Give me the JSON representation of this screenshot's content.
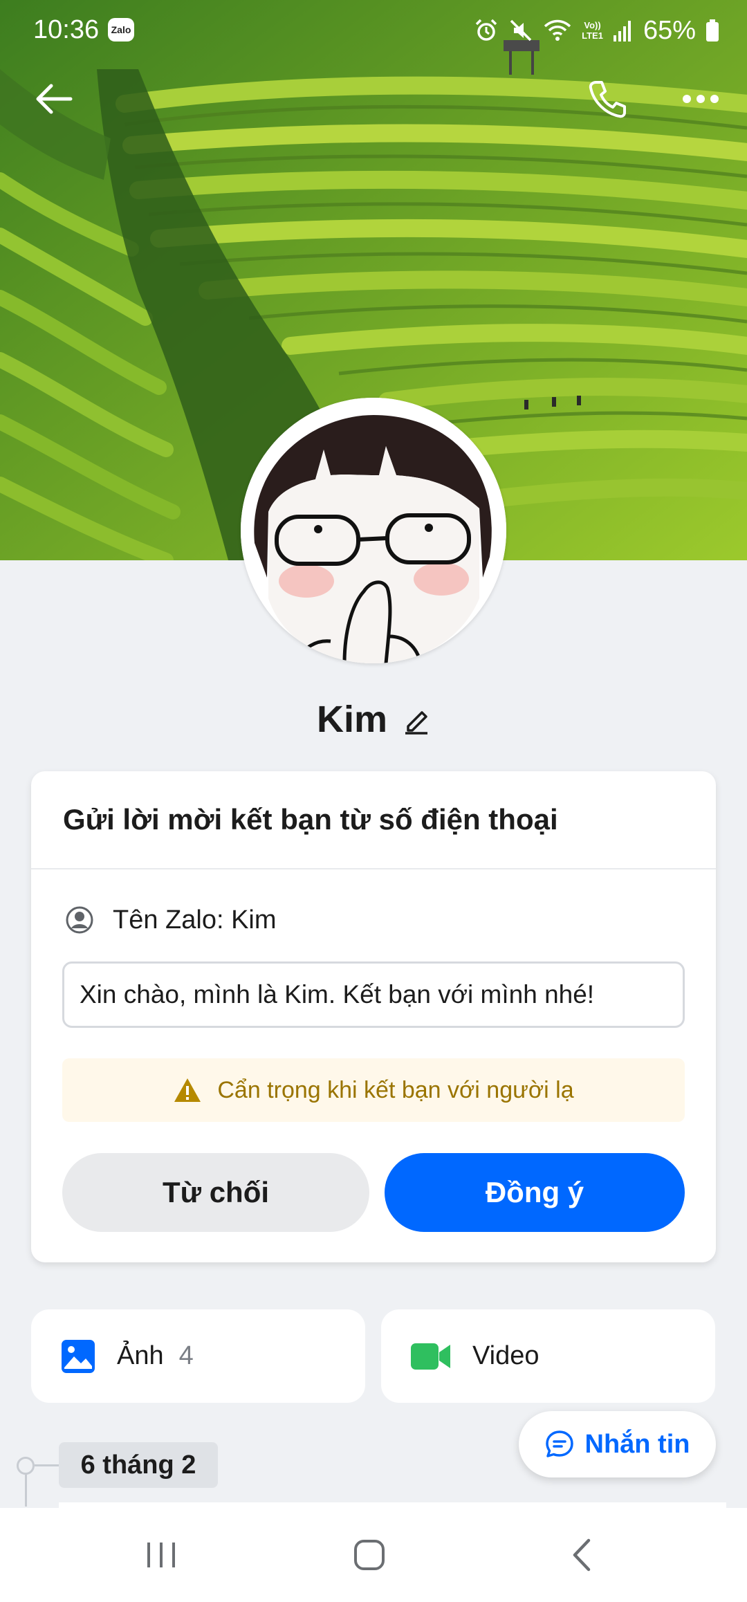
{
  "status_bar": {
    "time": "10:36",
    "app_badge": "Zalo",
    "network_label_top": "Vo))",
    "network_label_bottom": "LTE1",
    "battery": "65%"
  },
  "top_bar": {
    "back_icon": "arrow-left-icon",
    "call_icon": "phone-icon",
    "more_icon": "more-dots-icon"
  },
  "profile": {
    "name": "Kim",
    "edit_icon": "pencil-icon"
  },
  "friend_request": {
    "title": "Gửi lời mời kết bạn từ số điện thoại",
    "zalo_name": "Tên Zalo: Kim",
    "message": "Xin chào, mình là Kim. Kết bạn với mình nhé!",
    "warning": "Cẩn trọng khi kết bạn với người lạ",
    "decline_label": "Từ chối",
    "accept_label": "Đồng ý"
  },
  "media": {
    "photos_label": "Ảnh",
    "photos_count": "4",
    "video_label": "Video"
  },
  "timeline": {
    "date": "6 tháng 2"
  },
  "fab": {
    "label": "Nhắn tin"
  },
  "colors": {
    "primary": "#0068ff",
    "warning_text": "#9a7400",
    "warning_bg": "#fff8ea",
    "video_green": "#2fbf5f",
    "background": "#eff1f4"
  }
}
